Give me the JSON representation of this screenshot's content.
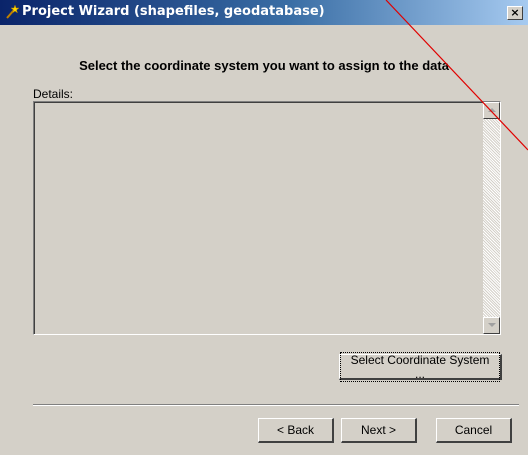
{
  "window": {
    "title": "Project Wizard (shapefiles, geodatabase)",
    "close_glyph": "×",
    "title_gradient_start": "#0a246a",
    "title_gradient_end": "#a6caf0"
  },
  "heading": "Select the coordinate system you want to assign to the data",
  "details": {
    "label": "Details:",
    "value": ""
  },
  "buttons": {
    "select_coordinate_system": "Select Coordinate System ...",
    "back": "< Back",
    "next": "Next >",
    "cancel": "Cancel"
  },
  "icons": {
    "title": "wizard-wand-icon",
    "close": "close-icon",
    "scroll_up": "scroll-up-arrow-icon",
    "scroll_down": "scroll-down-arrow-icon"
  },
  "overlay": {
    "annotation_line_color": "#e00000"
  }
}
